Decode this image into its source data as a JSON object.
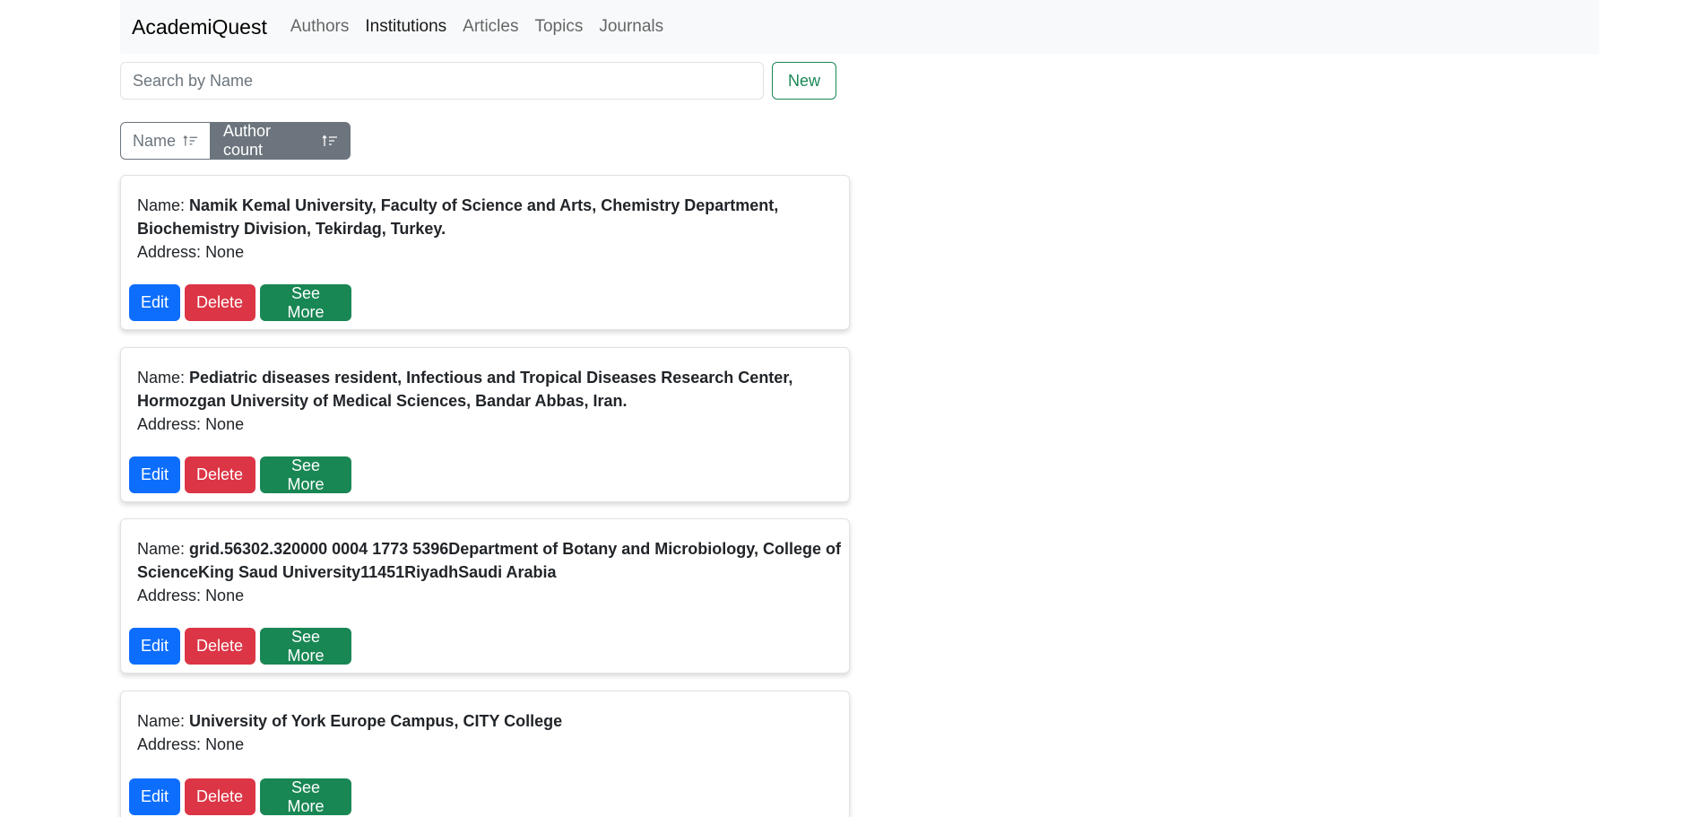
{
  "navbar": {
    "brand": "AcademiQuest",
    "links": [
      "Authors",
      "Institutions",
      "Articles",
      "Topics",
      "Journals"
    ]
  },
  "search": {
    "placeholder": "Search by Name",
    "value": ""
  },
  "new_button": "New",
  "sort": {
    "name_label": "Name",
    "author_count_label": "Author count"
  },
  "labels": {
    "name": "Name:",
    "address": "Address:"
  },
  "buttons": {
    "edit": "Edit",
    "delete": "Delete",
    "see_more": "See More"
  },
  "institutions": [
    {
      "name_line1": "Namik Kemal University, Faculty of Science and Arts, Chemistry Department,",
      "name_line2": "Biochemistry Division, Tekirdag, Turkey.",
      "address": "None"
    },
    {
      "name_line1": "Pediatric diseases resident, Infectious and Tropical Diseases Research Center,",
      "name_line2": "Hormozgan University of Medical Sciences, Bandar Abbas, Iran.",
      "address": "None"
    },
    {
      "name_line1": "grid.56302.320000 0004 1773 5396Department of Botany and Microbiology, College of",
      "name_line2": "ScienceKing Saud University11451RiyadhSaudi Arabia",
      "address": "None"
    },
    {
      "name_line1": "University of York Europe Campus, CITY College",
      "name_line2": "",
      "address": "None"
    }
  ]
}
